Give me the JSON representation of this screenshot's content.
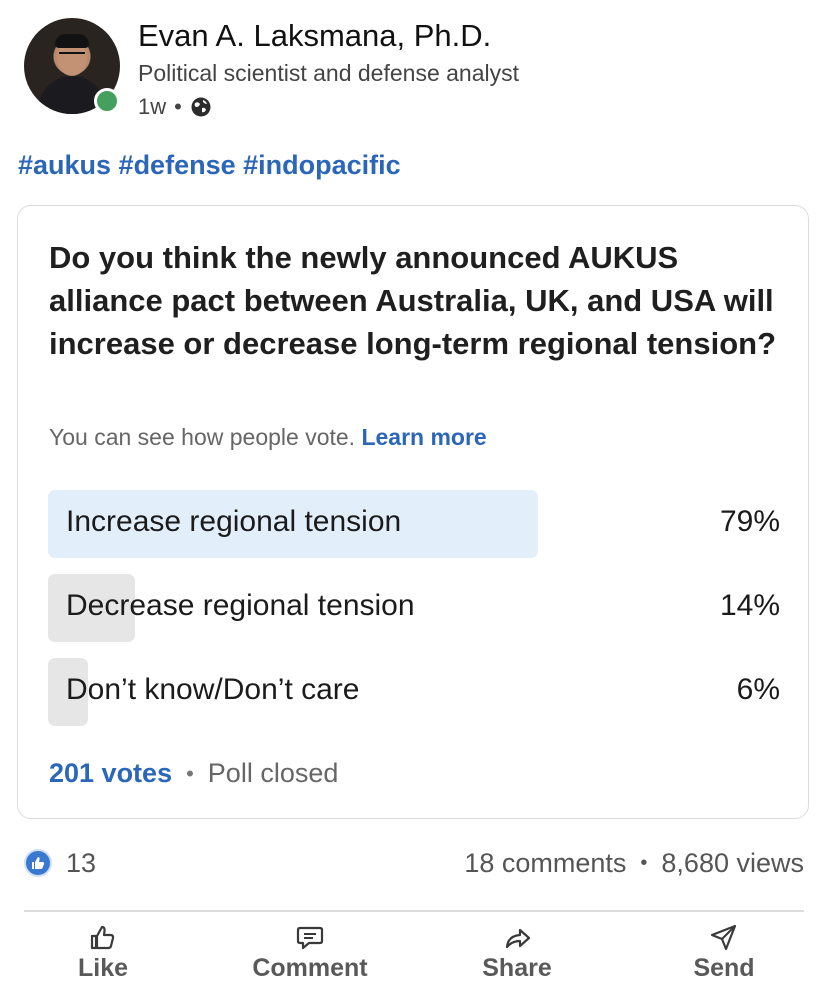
{
  "post": {
    "author": {
      "name": "Evan A. Laksmana, Ph.D.",
      "headline": "Political scientist and defense analyst",
      "time": "1w",
      "visibility_icon": "globe-icon",
      "online_color": "#45a060"
    },
    "hashtags": "#aukus #defense #indopacific"
  },
  "poll": {
    "question": "Do you think the newly announced AUKUS alliance pact between Australia, UK, and USA will increase or decrease long-term regional tension?",
    "note": "You can see how people vote.",
    "learn_more": "Learn more",
    "options": [
      {
        "label": "Increase regional tension",
        "percent_text": "79%",
        "percent": 79,
        "selected": true
      },
      {
        "label": "Decrease regional tension",
        "percent_text": "14%",
        "percent": 14,
        "selected": false
      },
      {
        "label": "Don’t know/Don’t care",
        "percent_text": "6%",
        "percent": 6,
        "selected": false
      }
    ],
    "votes": "201 votes",
    "status": "Poll closed",
    "accent_color": "#2b66b8"
  },
  "social": {
    "reactions": "13",
    "comments": "18 comments",
    "views": "8,680 views",
    "separator": "•"
  },
  "actions": [
    {
      "label": "Like",
      "icon": "thumbs-up-icon"
    },
    {
      "label": "Comment",
      "icon": "comment-icon"
    },
    {
      "label": "Share",
      "icon": "share-arrow-icon"
    },
    {
      "label": "Send",
      "icon": "send-icon"
    }
  ]
}
